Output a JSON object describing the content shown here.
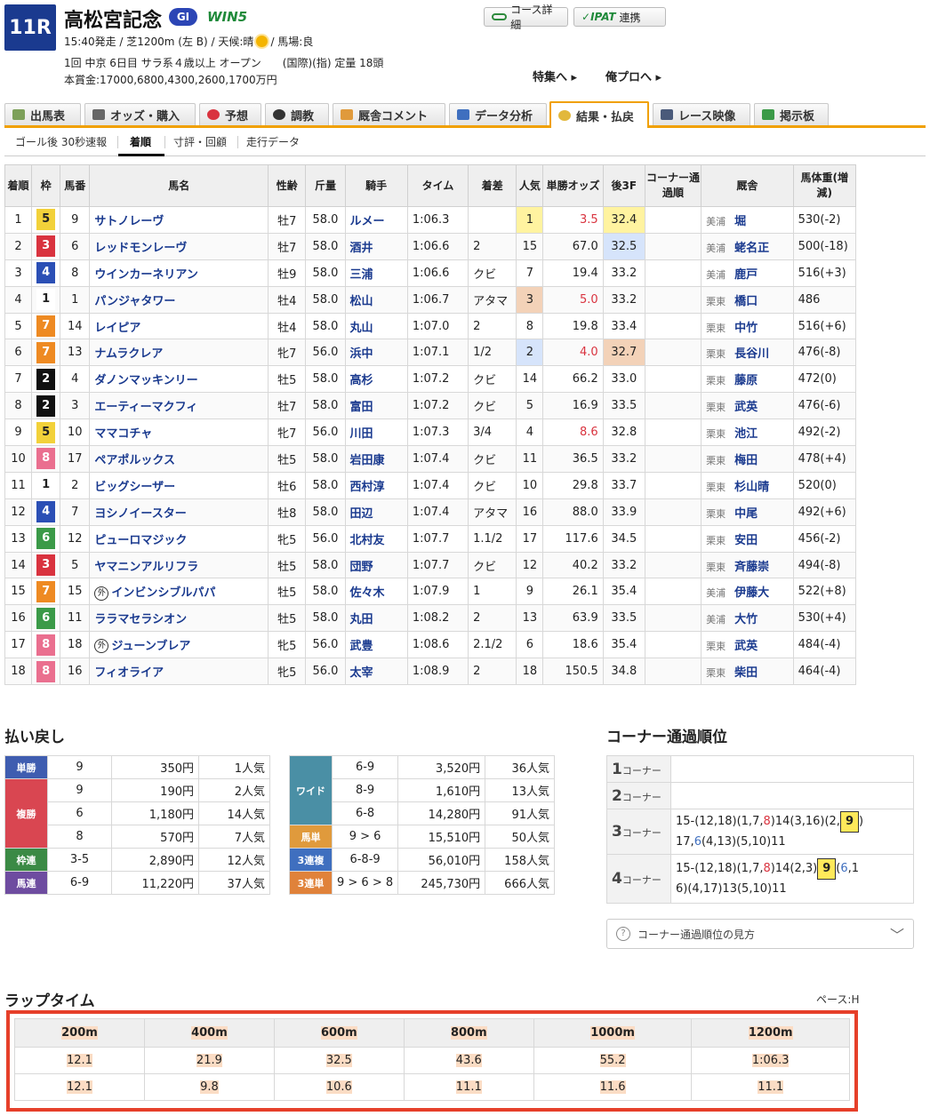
{
  "race": {
    "number": "11R",
    "name": "高松宮記念",
    "grade": "GI",
    "win5": "WIN5",
    "info_line1_a": "15:40発走 / 芝1200m (左 B) / 天候:晴",
    "info_line1_b": "/ 馬場:良",
    "info_line2": "1回 中京 6日目 サラ系４歳以上 オープン　　(国際)(指) 定量 18頭",
    "info_line3": "本賞金:17000,6800,4300,2600,1700万円"
  },
  "buttons": {
    "course": "コース詳細",
    "ipat_logo": "IPAT",
    "ipat": "連携"
  },
  "links": {
    "tokushu": "特集へ",
    "orepro": "俺プロへ"
  },
  "tabs": [
    "出馬表",
    "オッズ・購入",
    "予想",
    "調教",
    "厩舎コメント",
    "データ分析",
    "結果・払戻",
    "レース映像",
    "掲示板"
  ],
  "subtabs": [
    "ゴール後 30秒速報",
    "着順",
    "寸評・回顧",
    "走行データ"
  ],
  "result_headers": [
    "着順",
    "枠",
    "馬番",
    "馬名",
    "性齢",
    "斤量",
    "騎手",
    "タイム",
    "着差",
    "人気",
    "単勝オッズ",
    "後3F",
    "コーナー通過順",
    "厩舎",
    "馬体重(増減)"
  ],
  "colors": {
    "waku1": "#ffffff",
    "waku2": "#111111",
    "waku3": "#d9333f",
    "waku4": "#2b4fb5",
    "waku5": "#f2d13a",
    "waku6": "#3b9a48",
    "waku7": "#ee8a22",
    "waku8": "#ea6f8f",
    "pop1": "#fff3a0",
    "pop2": "#d6e4fb",
    "pop3": "#f3d2b8",
    "accent": "#f0a000",
    "lap_border": "#e6402a"
  },
  "results": [
    {
      "rank": "1",
      "waku": "5",
      "num": "9",
      "name": "サトノレーヴ",
      "sex_age": "牡7",
      "weight": "58.0",
      "jockey": "ルメー",
      "time": "1:06.3",
      "margin": "",
      "pop": "1",
      "odds": "3.5",
      "last3f": "32.4",
      "corner": "",
      "belong": "美浦",
      "trainer": "堀",
      "body": "530(-2)"
    },
    {
      "rank": "2",
      "waku": "3",
      "num": "6",
      "name": "レッドモンレーヴ",
      "sex_age": "牡7",
      "weight": "58.0",
      "jockey": "酒井",
      "time": "1:06.6",
      "margin": "2",
      "pop": "15",
      "odds": "67.0",
      "last3f": "32.5",
      "corner": "",
      "belong": "美浦",
      "trainer": "蛯名正",
      "body": "500(-18)"
    },
    {
      "rank": "3",
      "waku": "4",
      "num": "8",
      "name": "ウインカーネリアン",
      "sex_age": "牡9",
      "weight": "58.0",
      "jockey": "三浦",
      "time": "1:06.6",
      "margin": "クビ",
      "pop": "7",
      "odds": "19.4",
      "last3f": "33.2",
      "corner": "",
      "belong": "美浦",
      "trainer": "鹿戸",
      "body": "516(+3)"
    },
    {
      "rank": "4",
      "waku": "1",
      "num": "1",
      "name": "パンジャタワー",
      "sex_age": "牡4",
      "weight": "58.0",
      "jockey": "松山",
      "time": "1:06.7",
      "margin": "アタマ",
      "pop": "3",
      "odds": "5.0",
      "last3f": "33.2",
      "corner": "",
      "belong": "栗東",
      "trainer": "橋口",
      "body": "486"
    },
    {
      "rank": "5",
      "waku": "7",
      "num": "14",
      "name": "レイピア",
      "sex_age": "牡4",
      "weight": "58.0",
      "jockey": "丸山",
      "time": "1:07.0",
      "margin": "2",
      "pop": "8",
      "odds": "19.8",
      "last3f": "33.4",
      "corner": "",
      "belong": "栗東",
      "trainer": "中竹",
      "body": "516(+6)"
    },
    {
      "rank": "6",
      "waku": "7",
      "num": "13",
      "name": "ナムラクレア",
      "sex_age": "牝7",
      "weight": "56.0",
      "jockey": "浜中",
      "time": "1:07.1",
      "margin": "1/2",
      "pop": "2",
      "odds": "4.0",
      "last3f": "32.7",
      "corner": "",
      "belong": "栗東",
      "trainer": "長谷川",
      "body": "476(-8)"
    },
    {
      "rank": "7",
      "waku": "2",
      "num": "4",
      "name": "ダノンマッキンリー",
      "sex_age": "牡5",
      "weight": "58.0",
      "jockey": "高杉",
      "time": "1:07.2",
      "margin": "クビ",
      "pop": "14",
      "odds": "66.2",
      "last3f": "33.0",
      "corner": "",
      "belong": "栗東",
      "trainer": "藤原",
      "body": "472(0)"
    },
    {
      "rank": "8",
      "waku": "2",
      "num": "3",
      "name": "エーティーマクフィ",
      "sex_age": "牡7",
      "weight": "58.0",
      "jockey": "富田",
      "time": "1:07.2",
      "margin": "クビ",
      "pop": "5",
      "odds": "16.9",
      "last3f": "33.5",
      "corner": "",
      "belong": "栗東",
      "trainer": "武英",
      "body": "476(-6)"
    },
    {
      "rank": "9",
      "waku": "5",
      "num": "10",
      "name": "ママコチャ",
      "sex_age": "牝7",
      "weight": "56.0",
      "jockey": "川田",
      "time": "1:07.3",
      "margin": "3/4",
      "pop": "4",
      "odds": "8.6",
      "last3f": "32.8",
      "corner": "",
      "belong": "栗東",
      "trainer": "池江",
      "body": "492(-2)"
    },
    {
      "rank": "10",
      "waku": "8",
      "num": "17",
      "name": "ペアポルックス",
      "sex_age": "牡5",
      "weight": "58.0",
      "jockey": "岩田康",
      "time": "1:07.4",
      "margin": "クビ",
      "pop": "11",
      "odds": "36.5",
      "last3f": "33.2",
      "corner": "",
      "belong": "栗東",
      "trainer": "梅田",
      "body": "478(+4)"
    },
    {
      "rank": "11",
      "waku": "1",
      "num": "2",
      "name": "ビッグシーザー",
      "sex_age": "牡6",
      "weight": "58.0",
      "jockey": "西村淳",
      "time": "1:07.4",
      "margin": "クビ",
      "pop": "10",
      "odds": "29.8",
      "last3f": "33.7",
      "corner": "",
      "belong": "栗東",
      "trainer": "杉山晴",
      "body": "520(0)"
    },
    {
      "rank": "12",
      "waku": "4",
      "num": "7",
      "name": "ヨシノイースター",
      "sex_age": "牡8",
      "weight": "58.0",
      "jockey": "田辺",
      "time": "1:07.4",
      "margin": "アタマ",
      "pop": "16",
      "odds": "88.0",
      "last3f": "33.9",
      "corner": "",
      "belong": "栗東",
      "trainer": "中尾",
      "body": "492(+6)"
    },
    {
      "rank": "13",
      "waku": "6",
      "num": "12",
      "name": "ピューロマジック",
      "sex_age": "牝5",
      "weight": "56.0",
      "jockey": "北村友",
      "time": "1:07.7",
      "margin": "1.1/2",
      "pop": "17",
      "odds": "117.6",
      "last3f": "34.5",
      "corner": "",
      "belong": "栗東",
      "trainer": "安田",
      "body": "456(-2)"
    },
    {
      "rank": "14",
      "waku": "3",
      "num": "5",
      "name": "ヤマニンアルリフラ",
      "sex_age": "牡5",
      "weight": "58.0",
      "jockey": "団野",
      "time": "1:07.7",
      "margin": "クビ",
      "pop": "12",
      "odds": "40.2",
      "last3f": "33.2",
      "corner": "",
      "belong": "栗東",
      "trainer": "斉藤崇",
      "body": "494(-8)"
    },
    {
      "rank": "15",
      "waku": "7",
      "num": "15",
      "name": "インビンシブルパパ",
      "gai": "外",
      "sex_age": "牡5",
      "weight": "58.0",
      "jockey": "佐々木",
      "time": "1:07.9",
      "margin": "1",
      "pop": "9",
      "odds": "26.1",
      "last3f": "35.4",
      "corner": "",
      "belong": "美浦",
      "trainer": "伊藤大",
      "body": "522(+8)"
    },
    {
      "rank": "16",
      "waku": "6",
      "num": "11",
      "name": "ララマセラシオン",
      "sex_age": "牡5",
      "weight": "58.0",
      "jockey": "丸田",
      "time": "1:08.2",
      "margin": "2",
      "pop": "13",
      "odds": "63.9",
      "last3f": "33.5",
      "corner": "",
      "belong": "美浦",
      "trainer": "大竹",
      "body": "530(+4)"
    },
    {
      "rank": "17",
      "waku": "8",
      "num": "18",
      "name": "ジューンブレア",
      "gai": "外",
      "sex_age": "牝5",
      "weight": "56.0",
      "jockey": "武豊",
      "time": "1:08.6",
      "margin": "2.1/2",
      "pop": "6",
      "odds": "18.6",
      "last3f": "35.4",
      "corner": "",
      "belong": "栗東",
      "trainer": "武英",
      "body": "484(-4)"
    },
    {
      "rank": "18",
      "waku": "8",
      "num": "16",
      "name": "フィオライア",
      "sex_age": "牝5",
      "weight": "56.0",
      "jockey": "太宰",
      "time": "1:08.9",
      "margin": "2",
      "pop": "18",
      "odds": "150.5",
      "last3f": "34.8",
      "corner": "",
      "belong": "栗東",
      "trainer": "柴田",
      "body": "464(-4)"
    }
  ],
  "payout_title": "払い戻し",
  "payout_left": [
    {
      "type": "単勝",
      "rows": [
        {
          "combo": "9",
          "amount": "350円",
          "pop": "1人気"
        }
      ]
    },
    {
      "type": "複勝",
      "rows": [
        {
          "combo": "9",
          "amount": "190円",
          "pop": "2人気"
        },
        {
          "combo": "6",
          "amount": "1,180円",
          "pop": "14人気"
        },
        {
          "combo": "8",
          "amount": "570円",
          "pop": "7人気"
        }
      ]
    },
    {
      "type": "枠連",
      "rows": [
        {
          "combo": "3-5",
          "amount": "2,890円",
          "pop": "12人気"
        }
      ]
    },
    {
      "type": "馬連",
      "rows": [
        {
          "combo": "6-9",
          "amount": "11,220円",
          "pop": "37人気"
        }
      ]
    }
  ],
  "payout_right": [
    {
      "type": "ワイド",
      "rows": [
        {
          "combo": "6-9",
          "amount": "3,520円",
          "pop": "36人気"
        },
        {
          "combo": "8-9",
          "amount": "1,610円",
          "pop": "13人気"
        },
        {
          "combo": "6-8",
          "amount": "14,280円",
          "pop": "91人気"
        }
      ]
    },
    {
      "type": "馬単",
      "rows": [
        {
          "combo": "9 > 6",
          "amount": "15,510円",
          "pop": "50人気"
        }
      ]
    },
    {
      "type": "3連複",
      "rows": [
        {
          "combo": "6-8-9",
          "amount": "56,010円",
          "pop": "158人気"
        }
      ]
    },
    {
      "type": "3連単",
      "rows": [
        {
          "combo": "9 > 6 > 8",
          "amount": "245,730円",
          "pop": "666人気"
        }
      ]
    }
  ],
  "corner": {
    "title": "コーナー通過順位",
    "label": "コーナー",
    "c3_line1_a": "15-(12,18)(1,7,",
    "c3_line1_red": "8",
    "c3_line1_b": ")14(3,16)(2,",
    "c3_hl": "9",
    "c3_line1_c": ")",
    "c3_line2_a": "17,",
    "c3_line2_blue": "6",
    "c3_line2_b": "(4,13)(5,10)11",
    "c4_line1_a": "15-(12,18)(1,7,",
    "c4_line1_red": "8",
    "c4_line1_b": ")14(2,3)",
    "c4_hl": "9",
    "c4_line1_c": "(",
    "c4_line1_blue": "6",
    "c4_line1_d": ",1",
    "c4_line2": "6)(4,17)13(5,10)11",
    "help": "コーナー通過順位の見方"
  },
  "lap": {
    "title": "ラップタイム",
    "pace": "ペース:H",
    "distances": [
      "200m",
      "400m",
      "600m",
      "800m",
      "1000m",
      "1200m"
    ],
    "cumulative": [
      "12.1",
      "21.9",
      "32.5",
      "43.6",
      "55.2",
      "1:06.3"
    ],
    "splits": [
      "12.1",
      "9.8",
      "10.6",
      "11.1",
      "11.6",
      "11.1"
    ]
  }
}
